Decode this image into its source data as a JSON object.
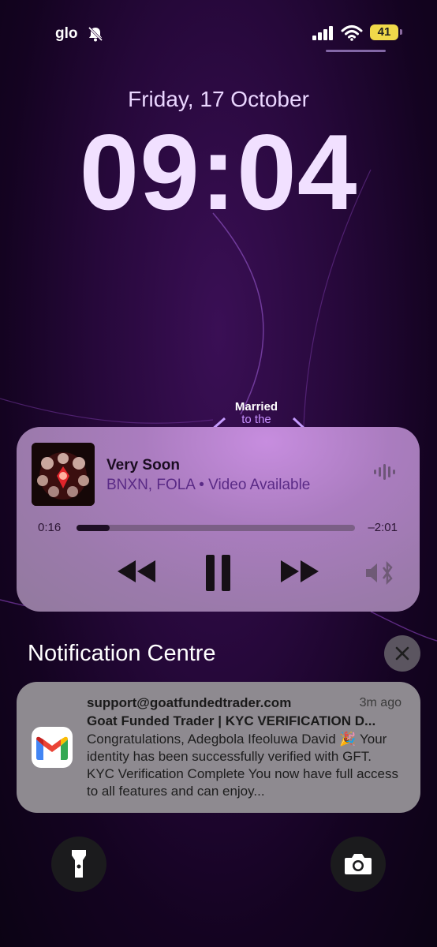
{
  "status_bar": {
    "carrier": "glo",
    "battery": "41",
    "icons": [
      "bell-slash-icon",
      "signal-bars-icon",
      "wifi-icon",
      "battery-icon"
    ]
  },
  "lock_screen": {
    "date": "Friday, 17 October",
    "time": "09:04",
    "wallpaper_text_line1": "Married",
    "wallpaper_text_line2": "to the"
  },
  "now_playing": {
    "title": "Very Soon",
    "artist_line": "BNXN, FOLA • Video Available",
    "elapsed": "0:16",
    "remaining": "–2:01",
    "progress_fraction": 0.12,
    "controls": [
      "rewind-icon",
      "pause-icon",
      "fast-forward-icon",
      "airplay-speaker-icon"
    ]
  },
  "notification_centre": {
    "title": "Notification Centre",
    "notifications": [
      {
        "app_icon": "gmail-icon",
        "sender": "support@goatfundedtrader.com",
        "time": "3m ago",
        "subject": "Goat Funded Trader | KYC VERIFICATION D...",
        "body": "Congratulations, Adegbola Ifeoluwa David 🎉 Your identity has been successfully verified with GFT. KYC Verification Complete You now have full access to all features and can enjoy..."
      }
    ]
  },
  "quick_actions": [
    "flashlight-icon",
    "camera-icon"
  ],
  "colors": {
    "accent": "#f1e0ff",
    "player_bg": "#a97dbf",
    "notification_bg": "#8e8a90",
    "battery": "#f0d94a"
  }
}
